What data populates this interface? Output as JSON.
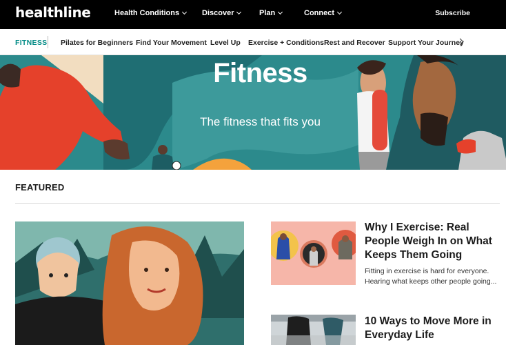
{
  "header": {
    "logo": "healthline",
    "nav": [
      "Health Conditions",
      "Discover",
      "Plan",
      "Connect"
    ],
    "subscribe": "Subscribe"
  },
  "subnav": {
    "current": "FITNESS",
    "items": [
      "Pilates for Beginners",
      "Find Your Movement",
      "Level Up",
      "Exercise + Conditions",
      "Rest and Recover",
      "Support Your Journey"
    ]
  },
  "hero": {
    "title": "Fitness",
    "subtitle": "The fitness that fits you"
  },
  "featured": {
    "heading": "FEATURED",
    "articles": [
      {
        "title": "Why I Exercise: Real People Weigh In on What Keeps Them Going",
        "description": "Fitting in exercise is hard for everyone. Hearing what keeps other people going..."
      },
      {
        "title": "10 Ways to Move More in Everyday Life"
      }
    ]
  },
  "colors": {
    "accent": "#008a85",
    "hero_teal": "#2c8a8c",
    "topbar": "#000000"
  }
}
